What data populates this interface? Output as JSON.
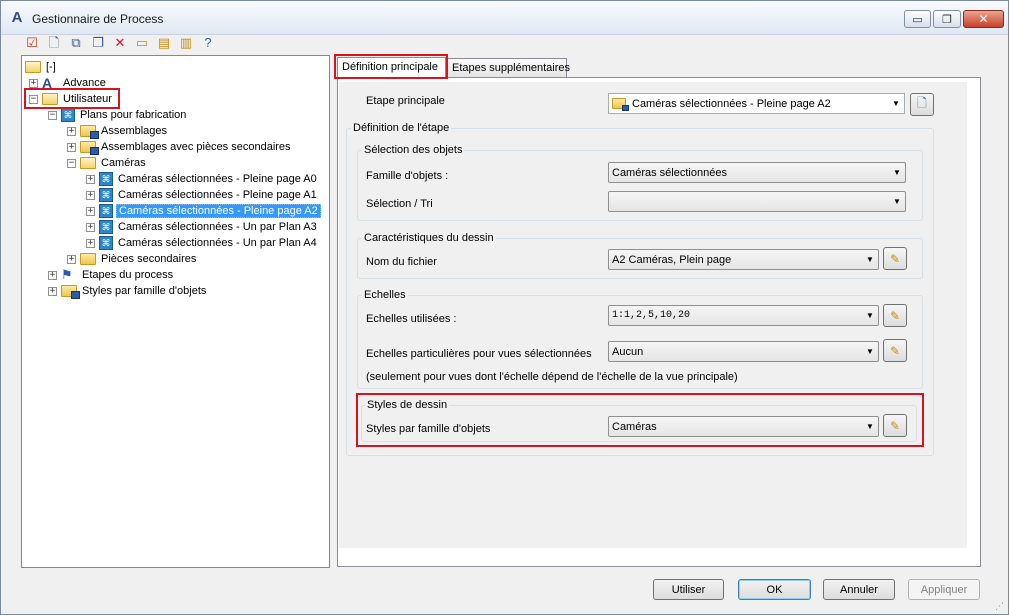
{
  "window": {
    "title": "Gestionnaire de Process",
    "app_icon": "A",
    "controls": {
      "minimize": "▭",
      "maximize": "❐",
      "close": "✕"
    }
  },
  "toolbar": [
    {
      "name": "validate-icon",
      "glyph": "☑",
      "color": "#c0392b"
    },
    {
      "name": "new-doc-icon",
      "glyph": "🗋",
      "color": "#3b5b8c"
    },
    {
      "name": "copy-icon",
      "glyph": "⧉",
      "color": "#3b5b8c"
    },
    {
      "name": "duplicate-icon",
      "glyph": "❐",
      "color": "#3b5b8c"
    },
    {
      "name": "delete-icon",
      "glyph": "✕",
      "color": "#d9121f"
    },
    {
      "name": "display-icon",
      "glyph": "▭",
      "color": "#c98a10"
    },
    {
      "name": "import-icon",
      "glyph": "▤",
      "color": "#c98a10"
    },
    {
      "name": "export-icon",
      "glyph": "▥",
      "color": "#c98a10"
    },
    {
      "name": "help-icon",
      "glyph": "?",
      "color": "#1f5fbf"
    }
  ],
  "tree": {
    "root": "[-]",
    "advance": "Advance",
    "utilisateur": "Utilisateur",
    "plans": "Plans pour fabrication",
    "assemblages": "Assemblages",
    "assemblages_secondaires": "Assemblages avec pièces secondaires",
    "cameras": "Caméras",
    "cam_a0": "Caméras sélectionnées - Pleine page A0",
    "cam_a1": "Caméras sélectionnées - Pleine page A1",
    "cam_a2": "Caméras sélectionnées - Pleine page A2",
    "cam_a3": "Caméras sélectionnées - Un par Plan A3",
    "cam_a4": "Caméras sélectionnées - Un par Plan A4",
    "pieces": "Pièces secondaires",
    "etapes": "Etapes du process",
    "styles": "Styles par famille d'objets",
    "expand_plus": "+",
    "expand_minus": "−"
  },
  "tabs": {
    "definition": "Définition principale",
    "etapes": "Etapes supplémentaires"
  },
  "form": {
    "etape_principale_label": "Etape principale",
    "etape_principale_value": "Caméras sélectionnées - Pleine page A2",
    "definition_group": "Définition de l'étape",
    "selection_group": "Sélection des objets",
    "famille_label": "Famille d'objets :",
    "famille_value": "Caméras sélectionnées",
    "selection_tri_label": "Sélection / Tri",
    "selection_tri_value": "",
    "caracteristiques_group": "Caractéristiques du dessin",
    "nom_fichier_label": "Nom du fichier",
    "nom_fichier_value": "A2 Caméras, Plein page",
    "echelles_group": "Echelles",
    "echelles_label": "Echelles utilisées :",
    "echelles_value": "1:1,2,5,10,20",
    "echelles_part_label": "Echelles particulières pour vues sélectionnées",
    "echelles_part_value": "Aucun",
    "echelles_note": "(seulement pour vues dont l'échelle dépend de l'échelle de la vue principale)",
    "styles_group": "Styles de dessin",
    "styles_label": "Styles par famille d'objets",
    "styles_value": "Caméras",
    "dropdown_arrow": "▼"
  },
  "buttons": {
    "utiliser": "Utiliser",
    "ok": "OK",
    "annuler": "Annuler",
    "appliquer": "Appliquer"
  },
  "colors": {
    "highlight_box": "#d9121f",
    "selection": "#3399ff"
  }
}
